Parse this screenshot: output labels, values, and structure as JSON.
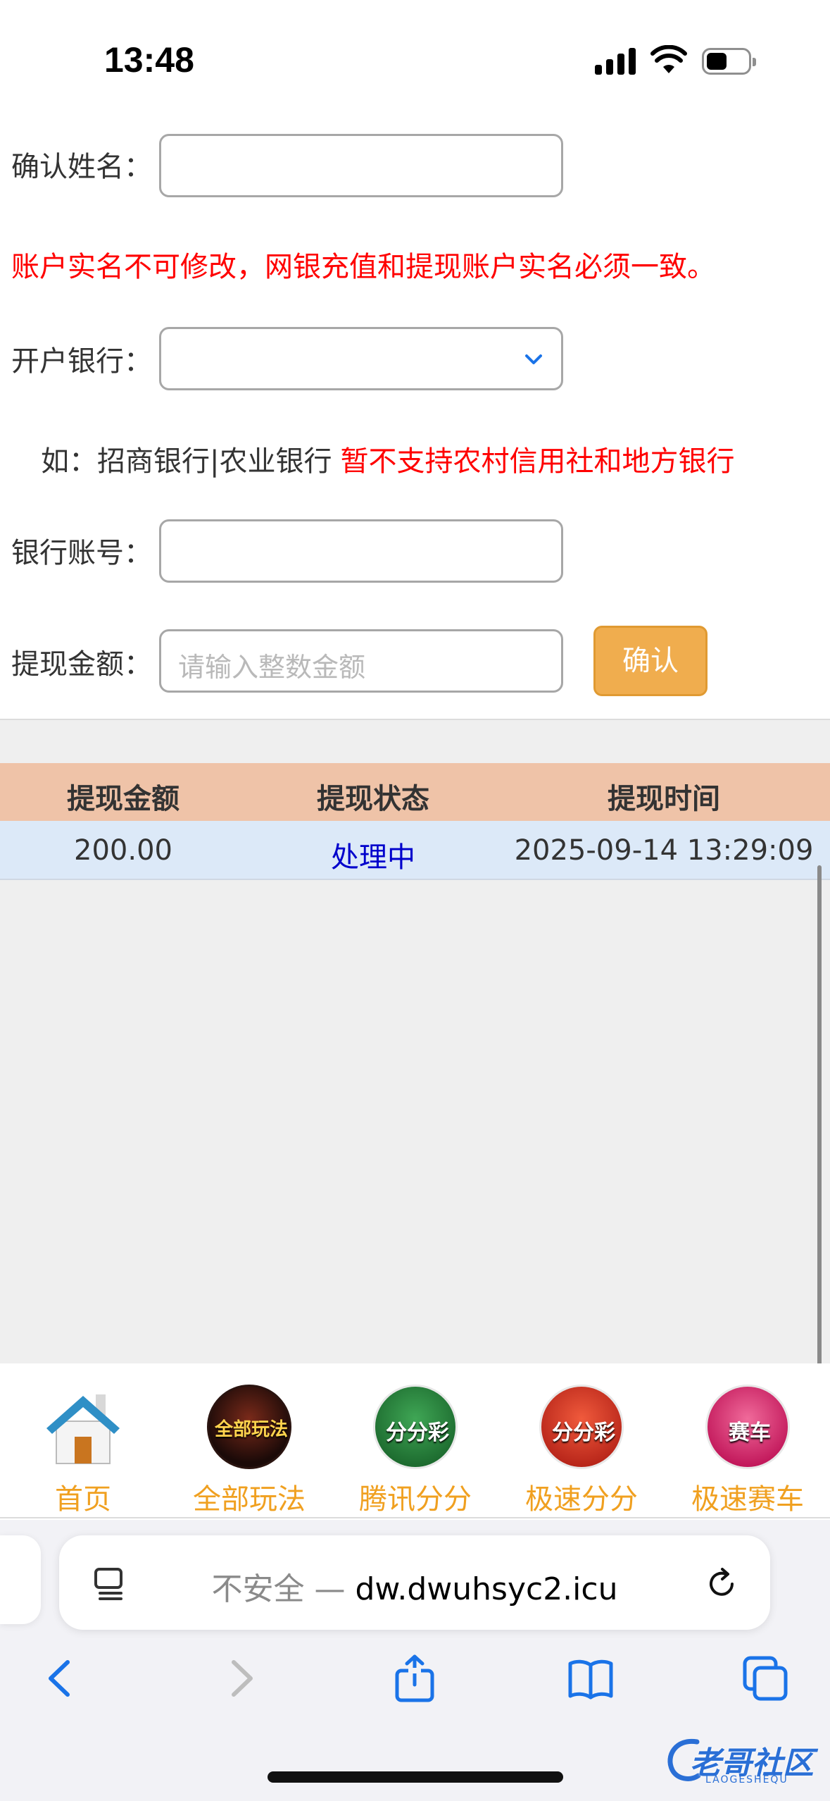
{
  "status_bar": {
    "time": "13:48"
  },
  "form": {
    "name_label": "确认姓名：",
    "notice": "账户实名不可修改，网银充值和提现账户实名必须一致。",
    "bank_label": "开户银行：",
    "example_prefix": "如：招商银行|农业银行",
    "example_warning": "暂不支持农村信用社和地方银行",
    "account_label": "银行账号：",
    "amount_label": "提现金额：",
    "amount_placeholder": "请输入整数金额",
    "confirm_button": "确认"
  },
  "table": {
    "headers": [
      "提现金额",
      "提现状态",
      "提现时间"
    ],
    "rows": [
      {
        "amount": "200.00",
        "status": "处理中",
        "time": "2025-09-14 13:29:09"
      }
    ]
  },
  "app_nav": {
    "items": [
      {
        "label": "首页",
        "icon": "house-icon"
      },
      {
        "label": "全部玩法",
        "icon_text": "全部玩法",
        "icon": "all-games-icon"
      },
      {
        "label": "腾讯分分",
        "icon_text": "分分彩",
        "icon": "tencent-ffc-icon"
      },
      {
        "label": "极速分分",
        "icon_text": "分分彩",
        "icon": "speed-ffc-icon"
      },
      {
        "label": "极速赛车",
        "icon_text": "赛车",
        "icon": "racing-icon"
      }
    ]
  },
  "browser": {
    "insecure_label": "不安全 — ",
    "domain": "dw.dwuhsyc2.icu"
  },
  "watermark": {
    "text": "老哥社区",
    "sub": "LAOGESHEQU"
  },
  "colors": {
    "accent": "#f0ad4e",
    "warning": "#ff0000",
    "table_header": "#efc3a8",
    "table_row": "#dce9f8",
    "nav_label": "#f0a020"
  }
}
